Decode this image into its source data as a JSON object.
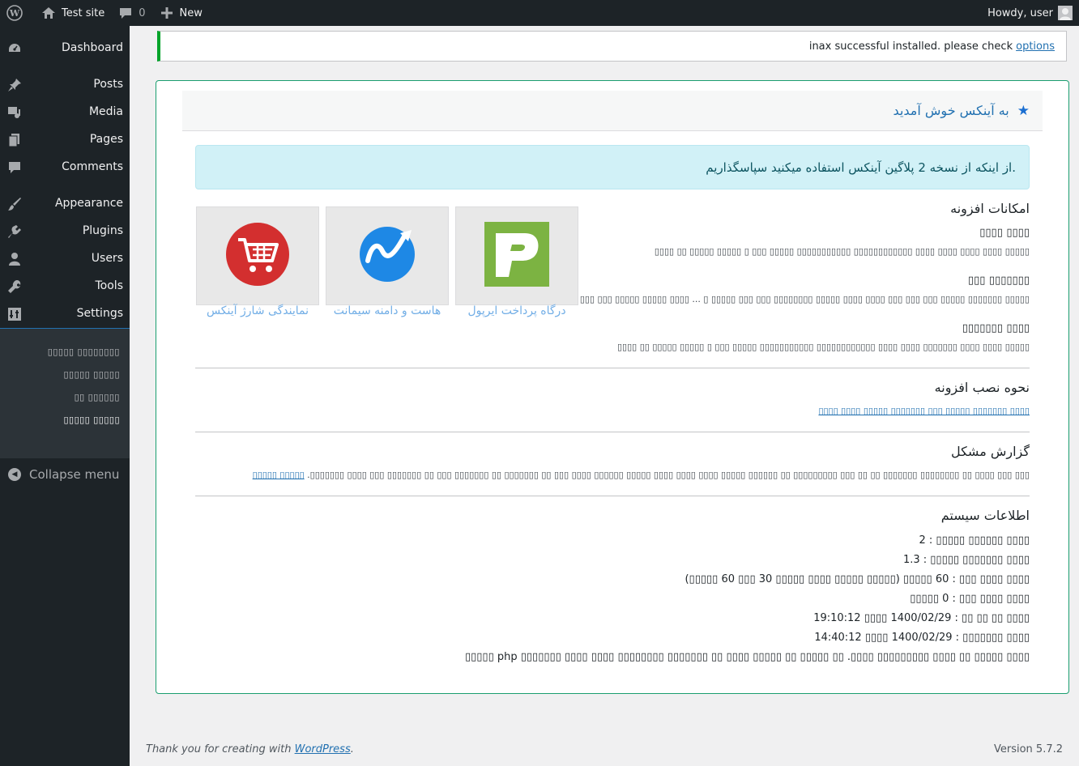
{
  "adminbar": {
    "site_name": "Test site",
    "comments_count": "0",
    "new_label": "New",
    "howdy": "Howdy, user"
  },
  "sidebar": {
    "items": [
      {
        "label": "Dashboard",
        "icon": "dashboard-icon"
      },
      {
        "label": "Posts",
        "icon": "pin-icon"
      },
      {
        "label": "Media",
        "icon": "media-icon"
      },
      {
        "label": "Pages",
        "icon": "pages-icon"
      },
      {
        "label": "Comments",
        "icon": "comment-icon"
      },
      {
        "label": "Appearance",
        "icon": "brush-icon"
      },
      {
        "label": "Plugins",
        "icon": "plugin-icon"
      },
      {
        "label": "Users",
        "icon": "user-icon"
      },
      {
        "label": "Tools",
        "icon": "wrench-icon"
      },
      {
        "label": "Settings",
        "icon": "settings-icon"
      },
      {
        "label": "▯▯▯▯▯ ▯▯▯▯▯▯▯▯",
        "icon": "cart-icon"
      }
    ],
    "submenu": [
      "▯▯▯▯▯ ▯▯▯▯▯▯▯▯",
      "▯▯▯▯▯ ▯▯▯▯▯",
      "▯▯ ▯▯▯▯▯▯",
      "▯▯▯▯▯ ▯▯▯▯▯"
    ],
    "collapse_label": "Collapse menu"
  },
  "notice": {
    "text": "inax successful installed. please check",
    "link": "options"
  },
  "panel": {
    "title": "به آینکس خوش آمدید",
    "info": ".از اینکه از نسخه 2 پلاگین آینکس استفاده میکنید سپاسگذاریم",
    "features_title": "امکانات افزونه",
    "features": [
      {
        "title": "▯▯▯▯ ▯▯▯▯",
        "text": "▯▯▯▯▯ ▯▯▯▯ ▯▯▯▯ ▯▯▯▯ ▯▯▯▯ ▯▯▯▯▯▯▯▯▯▯▯▯ ▯▯▯▯▯▯▯▯▯▯▯ ▯▯▯▯▯ ▯▯▯ ▯ ▯▯▯▯▯ ▯▯▯▯▯ ▯▯ ▯▯▯▯"
      },
      {
        "title": "▯▯▯▯▯▯▯ ▯▯▯",
        "text": "▯▯▯▯▯ ▯▯▯▯▯▯▯ ▯▯▯▯▯ ▯▯▯ ▯▯▯ ▯▯▯ ▯▯▯▯ ▯▯▯▯ ▯▯▯▯▯ ▯▯▯▯▯▯▯▯ ▯▯▯ ▯▯▯ ▯▯▯▯▯ ▯ ... ▯▯▯▯ ▯▯▯▯▯ ▯▯▯▯▯ ▯▯▯ ▯▯▯"
      },
      {
        "title": "▯▯▯▯ ▯▯▯▯▯▯▯",
        "text": "▯▯▯▯▯ ▯▯▯▯ ▯▯▯▯ ▯▯▯▯▯▯▯ ▯▯▯▯ ▯▯▯▯ ▯▯▯▯▯▯▯▯▯▯▯▯ ▯▯▯▯▯▯▯▯▯▯▯ ▯▯▯▯▯ ▯▯▯ ▯ ▯▯▯▯▯ ▯▯▯▯▯ ▯▯ ▯▯▯▯"
      }
    ],
    "cards": [
      {
        "label": "درگاه پرداخت ایرپول",
        "icon": "irpool-logo-icon"
      },
      {
        "label": "هاست و دامنه سیمانت",
        "icon": "simanet-logo-icon"
      },
      {
        "label": "نمایندگی شارژ آینکس",
        "icon": "inax-cart-logo-icon"
      }
    ],
    "install_title": "نحوه نصب افزونه",
    "install_link": "▯▯▯▯ ▯▯▯▯▯▯▯ ▯▯▯▯▯ ▯▯▯ ▯▯▯▯▯▯▯ ▯▯▯▯▯ ▯▯▯▯ ▯▯▯▯",
    "report_title": "گزارش مشکل",
    "report_text": "▯▯▯ ▯▯▯ ▯▯▯▯ ▯▯ ▯▯▯▯▯▯▯▯ ▯▯▯▯▯▯▯ ▯▯ ▯▯ ▯▯▯ ▯▯▯▯▯▯▯▯▯ ▯▯ ▯▯▯▯▯▯ ▯▯▯▯▯ ▯▯▯▯ ▯▯▯▯ ▯▯▯▯ ▯▯▯▯▯ ▯▯▯▯▯▯ ▯▯▯▯ ▯▯▯ ▯▯ ▯▯▯▯▯▯▯ ▯▯ ▯▯▯▯▯▯▯ ▯▯▯ ▯▯ ▯▯▯▯▯▯▯ ▯▯▯ ▯▯▯▯ ▯▯▯▯▯▯▯.",
    "report_link": "▯▯▯▯▯ ▯▯▯▯▯",
    "sys_title": "اطلاعات سیستم",
    "sys_lines": [
      "▯▯▯▯ ▯▯▯▯▯▯ ▯▯▯▯▯ : 2",
      "▯▯▯▯ ▯▯▯▯▯▯▯ ▯▯▯▯▯ : 1.3",
      "▯▯▯▯ ▯▯▯▯ ▯▯▯ : 60 ▯▯▯▯▯ (▯▯▯▯▯ ▯▯▯▯▯ ▯▯▯▯ ▯▯▯▯▯ 30 ▯▯▯ 60 ▯▯▯▯▯)",
      "▯▯▯▯ ▯▯▯▯ ▯▯▯ : 0 ▯▯▯▯▯",
      "▯▯▯▯ ▯▯ ▯▯ ▯▯ : 1400/02/29 ▯▯▯▯ 19:10:12",
      "▯▯▯▯ ▯▯▯▯▯▯▯ : 1400/02/29 ▯▯▯▯ 14:40:12",
      "▯▯▯▯ ▯▯▯▯▯ ▯▯ ▯▯▯▯ ▯▯▯▯▯▯▯▯▯ ▯▯▯▯. ▯▯ ▯▯▯▯▯ ▯▯ ▯▯▯▯▯ ▯▯▯▯ ▯▯ ▯▯▯▯▯▯▯ ▯▯▯▯▯▯▯▯ ▯▯▯▯ ▯▯▯▯ ▯▯▯▯▯▯▯ php ▯▯▯▯▯"
    ]
  },
  "footer": {
    "thanks": "Thank you for creating with",
    "wp_link": "WordPress",
    "period": ".",
    "version": "Version 5.7.2"
  }
}
